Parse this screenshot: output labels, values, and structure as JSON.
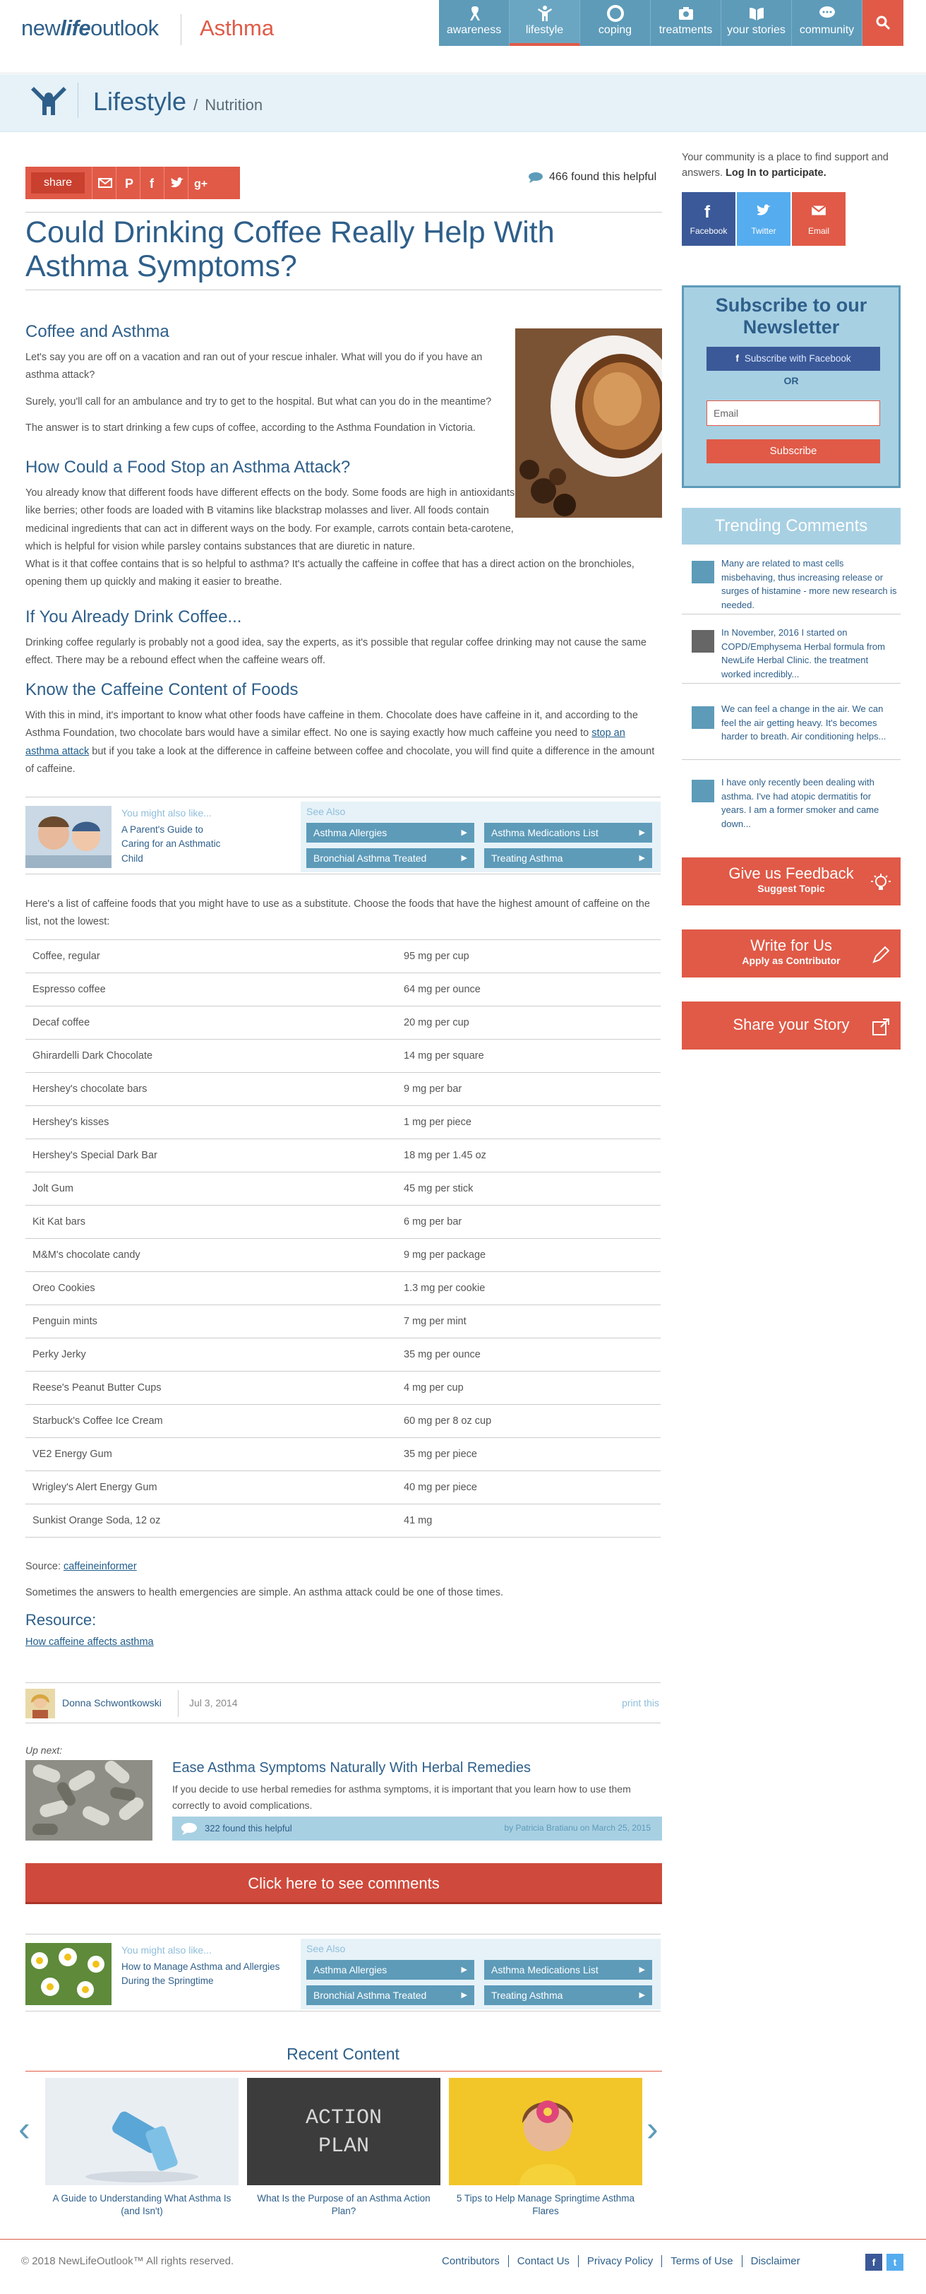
{
  "header": {
    "logo_pre": "new",
    "logo_mid": "life",
    "logo_post": "outlook",
    "condition": "Asthma",
    "nav": [
      {
        "label": "awareness",
        "icon": "ribbon-icon"
      },
      {
        "label": "lifestyle",
        "icon": "person-icon"
      },
      {
        "label": "coping",
        "icon": "lifebuoy-icon"
      },
      {
        "label": "treatments",
        "icon": "camera-icon"
      },
      {
        "label": "your stories",
        "icon": "book-icon"
      },
      {
        "label": "community",
        "icon": "chat-icon"
      }
    ],
    "search_icon": "search-icon"
  },
  "band": {
    "title": "Lifestyle",
    "sep": "/",
    "sub": "Nutrition"
  },
  "share": {
    "label": "share",
    "icons": [
      "mail-icon",
      "pinterest-icon",
      "facebook-icon",
      "twitter-icon",
      "googleplus-icon"
    ],
    "helpful": "466 found this helpful"
  },
  "article": {
    "title": "Could Drinking Coffee Really Help With Asthma Symptoms?",
    "s1_heading": "Coffee and Asthma",
    "s1_p1": "Let's say you are off on a vacation and ran out of your rescue inhaler. What will you do if you have an asthma attack?",
    "s1_p2": "Surely, you'll call for an ambulance and try to get to the hospital. But what can you do in the meantime?",
    "s1_p3": "The answer is to start drinking a few cups of coffee, according to the Asthma Foundation in Victoria.",
    "s2_heading": "How Could a Food Stop an Asthma Attack?",
    "s2_p1": "You already know that different foods have different effects on the body. Some foods are high in antioxidants like berries; other foods are loaded with B vitamins like blackstrap molasses and liver. All foods contain medicinal ingredients that can act in different ways on the body. For example, carrots contain beta-carotene, which is helpful for vision while parsley contains substances that are diuretic in nature.",
    "s2_p2": "What is it that coffee contains that is so helpful to asthma? It's actually the caffeine in coffee that has a direct action on the bronchioles, opening them up quickly and making it easier to breathe.",
    "s3_heading": "If You Already Drink Coffee...",
    "s3_p1": "Drinking coffee regularly is probably not a good idea, say the experts, as it's possible that regular coffee drinking may not cause the same effect. There may be a rebound effect when the caffeine wears off.",
    "s4_heading": "Know the Caffeine Content of Foods",
    "s4_p1_a": "With this in mind, it's important to know what other foods have caffeine in them. Chocolate does have caffeine in it, and according to the Asthma Foundation, two chocolate bars would have a similar effect. No one is saying exactly how much caffeine you need to ",
    "s4_link": "stop an asthma attack",
    "s4_p1_b": " but if you take a look at the difference in caffeine between coffee and chocolate, you will find quite a difference in the amount of caffeine.",
    "list_intro": "Here's a list of caffeine foods that you might have to use as a substitute. Choose the foods that have the highest amount of caffeine on the list, not the lowest:",
    "caffeine_table": [
      [
        "Coffee, regular",
        "95 mg per cup"
      ],
      [
        "Espresso coffee",
        "64 mg per ounce"
      ],
      [
        "Decaf coffee",
        "20 mg per cup"
      ],
      [
        "Ghirardelli Dark Chocolate",
        "14 mg per square"
      ],
      [
        "Hershey's chocolate bars",
        "9 mg per bar"
      ],
      [
        "Hershey's kisses",
        "1 mg per piece"
      ],
      [
        "Hershey's Special Dark Bar",
        "18 mg per 1.45 oz"
      ],
      [
        "Jolt Gum",
        "45 mg per stick"
      ],
      [
        "Kit Kat bars",
        "6 mg per bar"
      ],
      [
        "M&M's chocolate candy",
        "9 mg per package"
      ],
      [
        "Oreo Cookies",
        "1.3 mg per cookie"
      ],
      [
        "Penguin mints",
        "7 mg per mint"
      ],
      [
        "Perky Jerky",
        "35 mg per ounce"
      ],
      [
        "Reese's Peanut Butter Cups",
        "4 mg per cup"
      ],
      [
        "Starbuck's Coffee Ice Cream",
        "60 mg per 8 oz cup"
      ],
      [
        "VE2 Energy Gum",
        "35 mg per piece"
      ],
      [
        "Wrigley's Alert Energy Gum",
        "40 mg per piece"
      ],
      [
        "Sunkist Orange Soda, 12 oz",
        "41 mg"
      ]
    ],
    "source_label": "Source: ",
    "source_link": "caffeineinformer",
    "closing": "Sometimes the answers to health emergencies are simple. An asthma attack could be one of those times.",
    "resource_heading": "Resource:",
    "resource_link": "How caffeine affects asthma"
  },
  "might_also_1": {
    "title": "You might also like...",
    "link": "A Parent's Guide to Caring for an Asthmatic Child",
    "see_also": "See Also",
    "buttons": [
      "Asthma Allergies",
      "Asthma Medications List",
      "Bronchial Asthma Treated",
      "Treating Asthma"
    ]
  },
  "might_also_2": {
    "title": "You might also like...",
    "link": "How to Manage Asthma and Allergies During the Springtime",
    "see_also": "See Also",
    "buttons": [
      "Asthma Allergies",
      "Asthma Medications List",
      "Bronchial Asthma Treated",
      "Treating Asthma"
    ]
  },
  "author": {
    "name": "Donna Schwontkowski",
    "date": "Jul 3, 2014",
    "print": "print this"
  },
  "upnext": {
    "label": "Up next:",
    "title": "Ease Asthma Symptoms Naturally With Herbal Remedies",
    "text": "If you decide to use herbal remedies for asthma symptoms, it is important that you learn how to use them correctly to avoid complications.",
    "helpful": "322 found this helpful",
    "byline": "by Patricia Bratianu on March 25, 2015"
  },
  "comments_cta": "Click here to see comments",
  "recent": {
    "title": "Recent Content",
    "items": [
      {
        "caption": "A Guide to Understanding What Asthma Is (and Isn't)"
      },
      {
        "caption": "What Is the Purpose of an Asthma Action Plan?",
        "img_text_1": "ACTION",
        "img_text_2": "PLAN"
      },
      {
        "caption": "5 Tips to Help Manage Springtime Asthma Flares"
      }
    ]
  },
  "sidebar": {
    "intro_a": "Your community is a place to find support and answers. ",
    "intro_b": "Log In to participate.",
    "social": [
      "Facebook",
      "Twitter",
      "Email"
    ],
    "newsletter_title": "Subscribe to our Newsletter",
    "fb_subscribe": "Subscribe with Facebook",
    "or": "OR",
    "email_placeholder": "Email",
    "subscribe": "Subscribe",
    "trending": "Trending Comments",
    "comments": [
      "Many are related to mast cells misbehaving, thus increasing release or surges of histamine - more new research is needed.",
      "In November, 2016 I started on COPD/Emphysema Herbal formula from NewLife Herbal Clinic. the treatment worked incredibly...",
      "We can feel a change in the air. We can feel the air getting heavy. It's becomes harder to breath. Air conditioning helps...",
      "I have only recently been dealing with asthma. I've had atopic dermatitis for years. I am a former smoker and came down..."
    ],
    "feedback_title": "Give us Feedback",
    "feedback_sub": "Suggest Topic",
    "write_title": "Write for Us",
    "write_sub": "Apply as Contributor",
    "story_title": "Share your Story"
  },
  "footer": {
    "copy": "© 2018 NewLifeOutlook™ All rights reserved.",
    "links": [
      "Contributors",
      "Contact Us",
      "Privacy Policy",
      "Terms of Use",
      "Disclaimer"
    ]
  },
  "colors": {
    "brand_blue": "#2e5f8a",
    "accent_red": "#e05a47",
    "nav_blue": "#5d9bb9"
  }
}
